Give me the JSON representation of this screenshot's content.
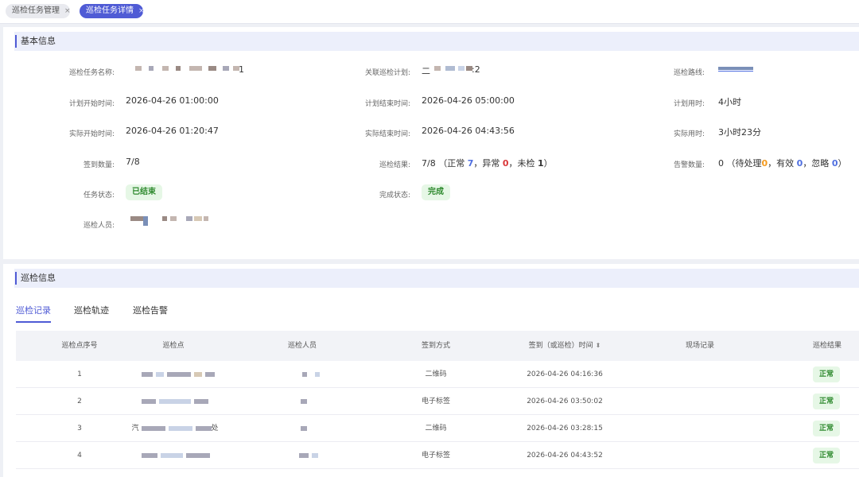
{
  "tabs": [
    {
      "label": "巡检任务管理",
      "close": "×"
    },
    {
      "label": "巡检任务详情",
      "close": "×"
    }
  ],
  "basic": {
    "section_title": "基本信息",
    "task_name_label": "巡检任务名称:",
    "task_name_suffix": "1",
    "plan_label": "关联巡检计划:",
    "plan_prefix": "二",
    "plan_suffix": ":2",
    "route_label": "巡检路线:",
    "plan_start_label": "计划开始时间:",
    "plan_start": "2026-04-26 01:00:00",
    "plan_end_label": "计划结束时间:",
    "plan_end": "2026-04-26 05:00:00",
    "plan_duration_label": "计划用时:",
    "plan_duration": "4小时",
    "actual_start_label": "实际开始时间:",
    "actual_start": "2026-04-26 01:20:47",
    "actual_end_label": "实际结束时间:",
    "actual_end": "2026-04-26 04:43:56",
    "actual_duration_label": "实际用时:",
    "actual_duration": "3小时23分",
    "checkin_label": "签到数量:",
    "checkin_value": "7/8",
    "result_label": "巡检结果:",
    "result_total": "7/8",
    "result_open": "（正常",
    "result_normal": "7",
    "result_abnormal_label": "，异常",
    "result_abnormal": "0",
    "result_unchecked_label": "，未检",
    "result_unchecked": "1",
    "result_close": "）",
    "alarm_label": "告警数量:",
    "alarm_total": "0",
    "alarm_open": "（待处理",
    "alarm_pending": "0",
    "alarm_valid_label": "，有效",
    "alarm_valid": "0",
    "alarm_ignore_label": "，忽略",
    "alarm_ignore": "0",
    "alarm_close": "）",
    "status_label": "任务状态:",
    "status_value": "已结束",
    "completion_label": "完成状态:",
    "completion_value": "完成",
    "inspector_label": "巡检人员:"
  },
  "inspection": {
    "section_title": "巡检信息",
    "tabs": [
      "巡检记录",
      "巡检轨迹",
      "巡检告警"
    ],
    "columns": [
      "巡检点序号",
      "巡检点",
      "巡检人员",
      "签到方式",
      "签到（或巡检）时间",
      "现场记录",
      "巡检结果"
    ],
    "sort_icon": "⬍",
    "rows": [
      {
        "seq": "1",
        "point_prefix": "",
        "point_suffix": "",
        "method": "二维码",
        "time": "2026-04-26 04:16:36",
        "result": "正常"
      },
      {
        "seq": "2",
        "point_prefix": "",
        "point_suffix": "",
        "method": "电子标签",
        "time": "2026-04-26 03:50:02",
        "result": "正常"
      },
      {
        "seq": "3",
        "point_prefix": "汽",
        "point_suffix": "处",
        "method": "二维码",
        "time": "2026-04-26 03:28:15",
        "result": "正常"
      },
      {
        "seq": "4",
        "point_prefix": "",
        "point_suffix": "",
        "method": "电子标签",
        "time": "2026-04-26 04:43:52",
        "result": "正常"
      }
    ]
  },
  "colors": {
    "accent": "#4f5bd5",
    "success_bg": "#e6f7e6",
    "success_text": "#2f8a2f",
    "warn": "#f39a1e",
    "danger": "#d9383a"
  }
}
